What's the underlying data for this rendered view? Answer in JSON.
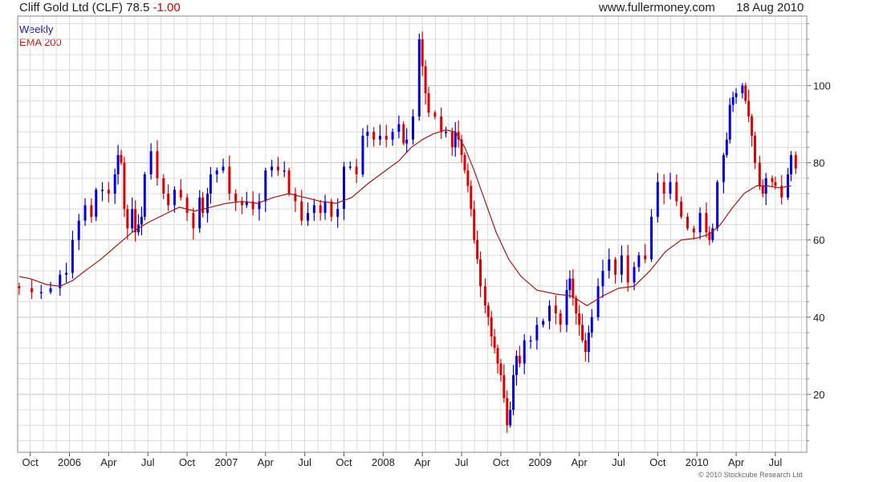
{
  "header": {
    "title": "Cliff Gold Ltd (CLF)",
    "last_price": "78.5",
    "change": "-1.00",
    "website": "www.fullermoney.com",
    "date": "18 Aug 2010"
  },
  "legend": {
    "weekly_label": "Weekly",
    "ema_label": "EMA 200"
  },
  "copyright": "© 2010 Stockcube Research Ltd",
  "colors": {
    "up": "#0000dd",
    "down": "#e00000",
    "ema": "#a01818",
    "grid": "#dcdcdc",
    "grid_major": "#c4c4c4",
    "text_blue": "#1a1aa0",
    "text_red": "#b01c1c"
  },
  "chart_data": {
    "type": "candlestick",
    "frequency": "weekly",
    "ylim": [
      5,
      118
    ],
    "x_range": [
      2005.67,
      2010.7
    ],
    "y_ticks": [
      20,
      40,
      60,
      80,
      100
    ],
    "y_axis_side": "right",
    "x_ticks": [
      {
        "label": "Oct",
        "t": 2005.75
      },
      {
        "label": "2006",
        "t": 2006.0
      },
      {
        "label": "Apr",
        "t": 2006.25
      },
      {
        "label": "Jul",
        "t": 2006.5
      },
      {
        "label": "Oct",
        "t": 2006.75
      },
      {
        "label": "2007",
        "t": 2007.0
      },
      {
        "label": "Apr",
        "t": 2007.25
      },
      {
        "label": "Jul",
        "t": 2007.5
      },
      {
        "label": "Oct",
        "t": 2007.75
      },
      {
        "label": "2008",
        "t": 2008.0
      },
      {
        "label": "Apr",
        "t": 2008.25
      },
      {
        "label": "Jul",
        "t": 2008.5
      },
      {
        "label": "Oct",
        "t": 2008.75
      },
      {
        "label": "2009",
        "t": 2009.0
      },
      {
        "label": "Apr",
        "t": 2009.25
      },
      {
        "label": "Jul",
        "t": 2009.5
      },
      {
        "label": "Oct",
        "t": 2009.75
      },
      {
        "label": "2010",
        "t": 2010.0
      },
      {
        "label": "Apr",
        "t": 2010.25
      },
      {
        "label": "Jul",
        "t": 2010.5
      }
    ],
    "grid": true,
    "close_series": [
      [
        2005.68,
        47.5
      ],
      [
        2005.76,
        46.5
      ],
      [
        2005.82,
        46.5
      ],
      [
        2005.88,
        47.5
      ],
      [
        2005.94,
        51
      ],
      [
        2005.98,
        51.5
      ],
      [
        2006.02,
        60
      ],
      [
        2006.06,
        65
      ],
      [
        2006.1,
        69
      ],
      [
        2006.14,
        66
      ],
      [
        2006.17,
        73
      ],
      [
        2006.21,
        73
      ],
      [
        2006.25,
        72
      ],
      [
        2006.29,
        77
      ],
      [
        2006.31,
        82
      ],
      [
        2006.33,
        80
      ],
      [
        2006.35,
        68
      ],
      [
        2006.37,
        63
      ],
      [
        2006.4,
        68
      ],
      [
        2006.42,
        62
      ],
      [
        2006.44,
        64
      ],
      [
        2006.46,
        66
      ],
      [
        2006.48,
        77
      ],
      [
        2006.52,
        83
      ],
      [
        2006.56,
        76
      ],
      [
        2006.6,
        72
      ],
      [
        2006.63,
        69
      ],
      [
        2006.67,
        73
      ],
      [
        2006.71,
        71
      ],
      [
        2006.75,
        67
      ],
      [
        2006.79,
        63
      ],
      [
        2006.83,
        71
      ],
      [
        2006.85,
        67
      ],
      [
        2006.88,
        72
      ],
      [
        2006.9,
        77
      ],
      [
        2006.94,
        78
      ],
      [
        2006.98,
        79
      ],
      [
        2007.02,
        72
      ],
      [
        2007.06,
        70
      ],
      [
        2007.1,
        69
      ],
      [
        2007.13,
        70
      ],
      [
        2007.17,
        68
      ],
      [
        2007.21,
        70
      ],
      [
        2007.25,
        78
      ],
      [
        2007.29,
        79
      ],
      [
        2007.33,
        78
      ],
      [
        2007.37,
        78
      ],
      [
        2007.4,
        72
      ],
      [
        2007.44,
        70
      ],
      [
        2007.48,
        65
      ],
      [
        2007.52,
        67
      ],
      [
        2007.56,
        69
      ],
      [
        2007.6,
        67
      ],
      [
        2007.63,
        70
      ],
      [
        2007.67,
        66
      ],
      [
        2007.71,
        68
      ],
      [
        2007.75,
        79
      ],
      [
        2007.79,
        79
      ],
      [
        2007.83,
        77
      ],
      [
        2007.87,
        87
      ],
      [
        2007.9,
        88
      ],
      [
        2007.94,
        86
      ],
      [
        2007.98,
        87
      ],
      [
        2008.02,
        86
      ],
      [
        2008.06,
        88
      ],
      [
        2008.1,
        90
      ],
      [
        2008.13,
        85
      ],
      [
        2008.15,
        86
      ],
      [
        2008.19,
        92
      ],
      [
        2008.23,
        112
      ],
      [
        2008.25,
        105
      ],
      [
        2008.27,
        98
      ],
      [
        2008.29,
        93
      ],
      [
        2008.33,
        92
      ],
      [
        2008.37,
        88
      ],
      [
        2008.4,
        88
      ],
      [
        2008.44,
        84
      ],
      [
        2008.46,
        88
      ],
      [
        2008.48,
        86
      ],
      [
        2008.5,
        82
      ],
      [
        2008.52,
        78
      ],
      [
        2008.54,
        74
      ],
      [
        2008.56,
        68
      ],
      [
        2008.58,
        60
      ],
      [
        2008.6,
        55
      ],
      [
        2008.62,
        48
      ],
      [
        2008.65,
        43
      ],
      [
        2008.67,
        40
      ],
      [
        2008.69,
        35
      ],
      [
        2008.71,
        32
      ],
      [
        2008.73,
        28
      ],
      [
        2008.75,
        25
      ],
      [
        2008.77,
        19
      ],
      [
        2008.79,
        12
      ],
      [
        2008.81,
        16
      ],
      [
        2008.83,
        25
      ],
      [
        2008.85,
        30
      ],
      [
        2008.87,
        28
      ],
      [
        2008.9,
        34
      ],
      [
        2008.94,
        34
      ],
      [
        2008.98,
        38
      ],
      [
        2009.02,
        39
      ],
      [
        2009.06,
        43
      ],
      [
        2009.1,
        41
      ],
      [
        2009.13,
        38
      ],
      [
        2009.17,
        47
      ],
      [
        2009.19,
        50
      ],
      [
        2009.21,
        45
      ],
      [
        2009.23,
        41
      ],
      [
        2009.25,
        38
      ],
      [
        2009.27,
        34
      ],
      [
        2009.29,
        31
      ],
      [
        2009.31,
        36
      ],
      [
        2009.33,
        40
      ],
      [
        2009.37,
        48
      ],
      [
        2009.4,
        52
      ],
      [
        2009.44,
        55
      ],
      [
        2009.48,
        51
      ],
      [
        2009.52,
        56
      ],
      [
        2009.56,
        49
      ],
      [
        2009.6,
        53
      ],
      [
        2009.63,
        56
      ],
      [
        2009.67,
        55
      ],
      [
        2009.71,
        66
      ],
      [
        2009.75,
        75
      ],
      [
        2009.79,
        72
      ],
      [
        2009.83,
        75
      ],
      [
        2009.87,
        70
      ],
      [
        2009.9,
        66
      ],
      [
        2009.94,
        63
      ],
      [
        2009.98,
        62
      ],
      [
        2010.02,
        67
      ],
      [
        2010.06,
        62
      ],
      [
        2010.08,
        60
      ],
      [
        2010.1,
        63
      ],
      [
        2010.13,
        75
      ],
      [
        2010.17,
        82
      ],
      [
        2010.19,
        86
      ],
      [
        2010.21,
        95
      ],
      [
        2010.23,
        97
      ],
      [
        2010.25,
        98
      ],
      [
        2010.29,
        100
      ],
      [
        2010.31,
        96
      ],
      [
        2010.33,
        92
      ],
      [
        2010.35,
        87
      ],
      [
        2010.37,
        80
      ],
      [
        2010.4,
        74
      ],
      [
        2010.42,
        72
      ],
      [
        2010.44,
        76
      ],
      [
        2010.48,
        75
      ],
      [
        2010.5,
        74
      ],
      [
        2010.54,
        71
      ],
      [
        2010.58,
        77
      ],
      [
        2010.6,
        82
      ],
      [
        2010.63,
        78.5
      ]
    ],
    "ema_200": [
      [
        2005.68,
        50.5
      ],
      [
        2005.75,
        50
      ],
      [
        2005.85,
        48.5
      ],
      [
        2005.94,
        48
      ],
      [
        2006.02,
        49.5
      ],
      [
        2006.1,
        52
      ],
      [
        2006.2,
        55
      ],
      [
        2006.3,
        58.5
      ],
      [
        2006.4,
        62
      ],
      [
        2006.5,
        64.5
      ],
      [
        2006.6,
        66.5
      ],
      [
        2006.7,
        68.5
      ],
      [
        2006.8,
        67.5
      ],
      [
        2006.9,
        68.5
      ],
      [
        2007.0,
        69.5
      ],
      [
        2007.1,
        70
      ],
      [
        2007.2,
        69.5
      ],
      [
        2007.3,
        71
      ],
      [
        2007.4,
        72
      ],
      [
        2007.5,
        71
      ],
      [
        2007.6,
        70
      ],
      [
        2007.7,
        69.5
      ],
      [
        2007.8,
        71
      ],
      [
        2007.9,
        74.5
      ],
      [
        2008.0,
        77.5
      ],
      [
        2008.1,
        80.5
      ],
      [
        2008.18,
        84
      ],
      [
        2008.25,
        86
      ],
      [
        2008.32,
        87.5
      ],
      [
        2008.4,
        88.5
      ],
      [
        2008.46,
        88
      ],
      [
        2008.52,
        84
      ],
      [
        2008.58,
        78
      ],
      [
        2008.65,
        70
      ],
      [
        2008.72,
        62
      ],
      [
        2008.8,
        55
      ],
      [
        2008.88,
        50.5
      ],
      [
        2008.98,
        47
      ],
      [
        2009.1,
        46
      ],
      [
        2009.2,
        45.5
      ],
      [
        2009.3,
        43
      ],
      [
        2009.4,
        45.5
      ],
      [
        2009.5,
        47.5
      ],
      [
        2009.6,
        48
      ],
      [
        2009.7,
        52
      ],
      [
        2009.8,
        57
      ],
      [
        2009.9,
        60
      ],
      [
        2010.0,
        60.5
      ],
      [
        2010.08,
        61.5
      ],
      [
        2010.15,
        64
      ],
      [
        2010.22,
        68
      ],
      [
        2010.3,
        72
      ],
      [
        2010.38,
        74
      ],
      [
        2010.45,
        74
      ],
      [
        2010.52,
        73.5
      ],
      [
        2010.6,
        74
      ]
    ]
  }
}
